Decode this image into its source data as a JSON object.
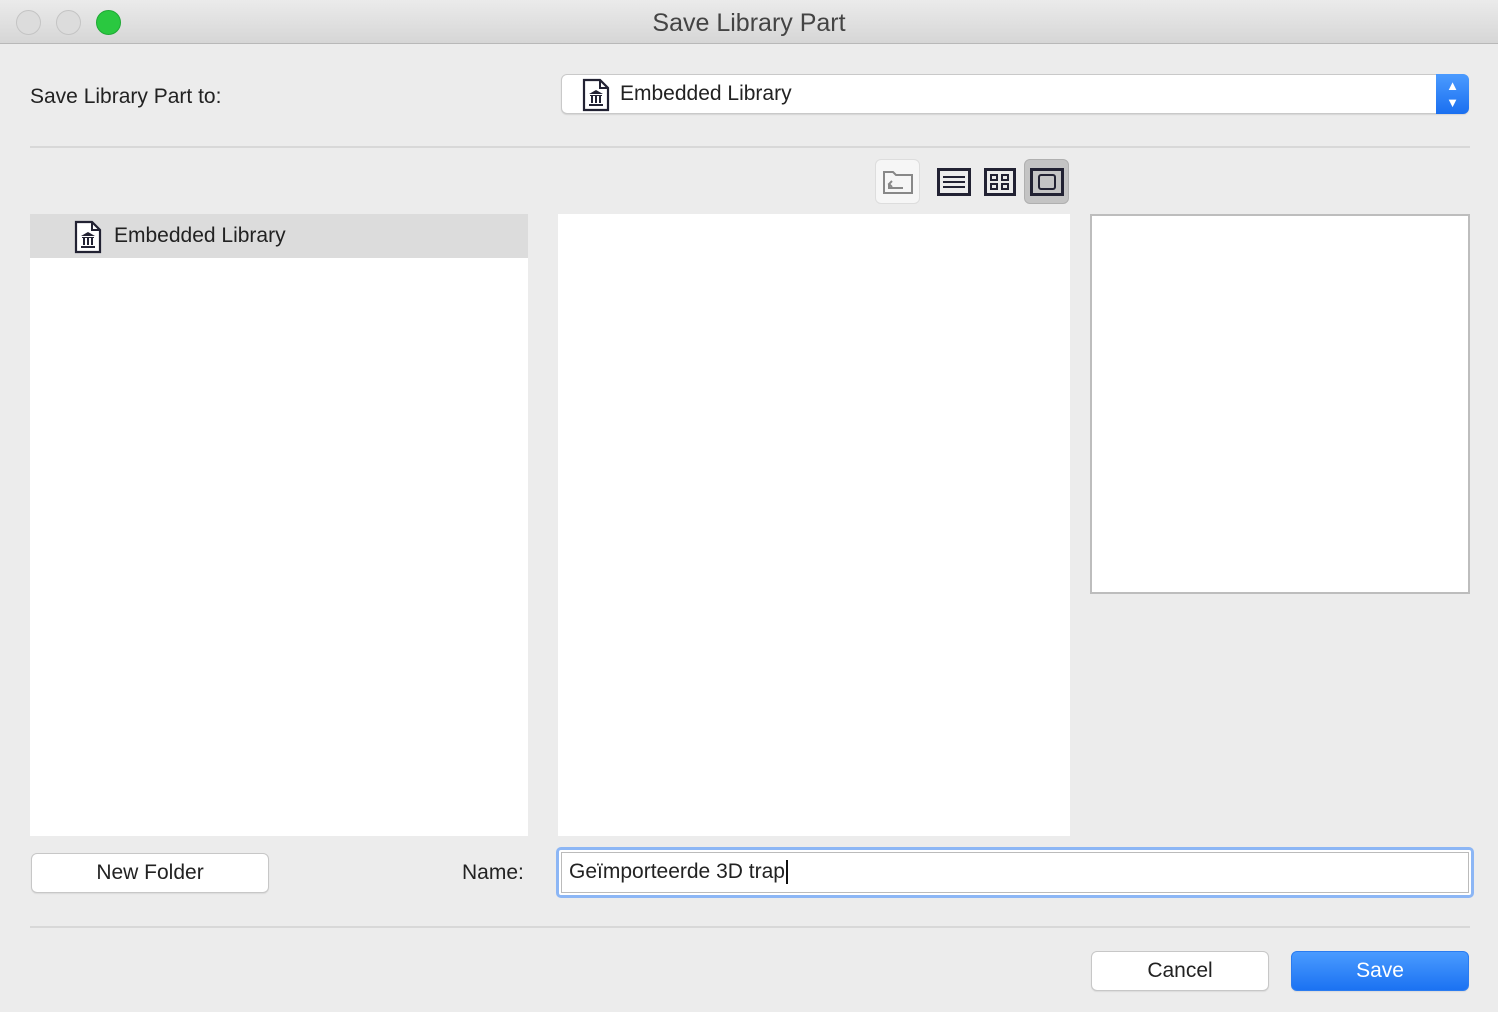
{
  "window": {
    "title": "Save Library Part"
  },
  "destination": {
    "label": "Save Library Part to:",
    "selected": "Embedded Library"
  },
  "tree": {
    "items": [
      {
        "label": "Embedded Library",
        "selected": true
      }
    ]
  },
  "name": {
    "label": "Name:",
    "value": "Geïmporteerde 3D trap"
  },
  "buttons": {
    "new_folder": "New Folder",
    "cancel": "Cancel",
    "save": "Save"
  },
  "colors": {
    "accent": "#1b72f2",
    "close": "#dcdcdc",
    "zoom": "#2ac840"
  }
}
